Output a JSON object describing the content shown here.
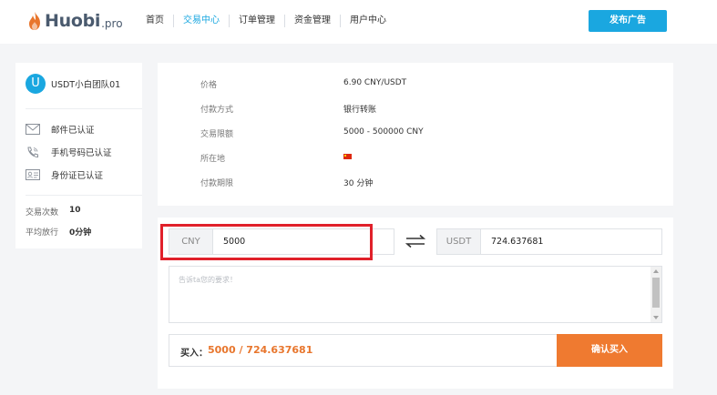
{
  "header": {
    "logo_text": "Huobi",
    "logo_suffix": ".pro",
    "nav": [
      {
        "label": "首页",
        "active": false
      },
      {
        "label": "交易中心",
        "active": true
      },
      {
        "label": "订单管理",
        "active": false
      },
      {
        "label": "资金管理",
        "active": false
      },
      {
        "label": "用户中心",
        "active": false
      }
    ],
    "post_ad_label": "发布广告"
  },
  "sidebar": {
    "avatar_letter": "U",
    "username": "USDT小白团队01",
    "verifications": [
      {
        "icon": "mail-icon",
        "label": "邮件已认证"
      },
      {
        "icon": "phone-icon",
        "label": "手机号码已认证"
      },
      {
        "icon": "id-card-icon",
        "label": "身份证已认证"
      }
    ],
    "stats": [
      {
        "label": "交易次数",
        "value": "10"
      },
      {
        "label": "平均放行",
        "value": "0分钟"
      }
    ]
  },
  "info": {
    "rows": [
      {
        "label": "价格",
        "value": "6.90 CNY/USDT"
      },
      {
        "label": "付款方式",
        "value": "银行转账"
      },
      {
        "label": "交易限额",
        "value": " 5000 - 500000 CNY"
      },
      {
        "label": "所在地",
        "value": ""
      },
      {
        "label": "付款期限",
        "value": "30 分钟"
      }
    ]
  },
  "trade": {
    "cny_tag": "CNY",
    "cny_value": "5000",
    "usdt_tag": "USDT",
    "usdt_value": "724.637681",
    "note_placeholder": "告诉ta您的要求！",
    "buy_label": "买入：",
    "buy_total": "5000 / 724.637681",
    "confirm_label": "确认买入"
  },
  "colors": {
    "accent": "#1aa7e0",
    "buy_orange": "#ef7a30",
    "highlight_red": "#e0202a"
  }
}
